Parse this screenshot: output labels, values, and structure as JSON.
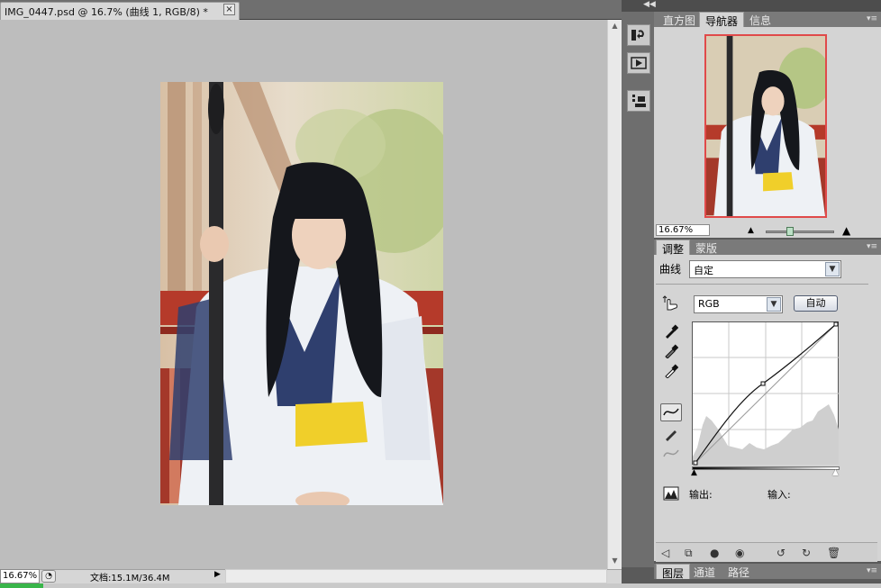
{
  "document": {
    "tab_title": "IMG_0447.psd @ 16.7% (曲线 1, RGB/8) *",
    "close_glyph": "×"
  },
  "status_bar": {
    "zoom": "16.67%",
    "doc_info": "文档:15.1M/36.4M",
    "menu_arrow": "▶"
  },
  "panel_collapse": "◀◀",
  "tool_strip": {
    "icons": [
      "history-brush-icon",
      "play-action-icon",
      "clone-source-icon"
    ]
  },
  "navigator_panel": {
    "tabs": [
      "直方图",
      "导航器",
      "信息"
    ],
    "active_tab": "导航器",
    "zoom": "16.67%",
    "view_box_color": "#e04a4a"
  },
  "adjustments_panel": {
    "tabs": [
      "调整",
      "蒙版"
    ],
    "active_tab": "调整",
    "preset_label": "曲线",
    "preset_value": "自定",
    "channel_value": "RGB",
    "auto_button": "自动",
    "output_label": "输出:",
    "input_label": "输入:"
  },
  "layers_panel": {
    "tabs": [
      "图层",
      "通道",
      "路径"
    ],
    "active_tab": "图层"
  },
  "colors": {
    "canvas_bg": "#bdbdbd",
    "panel_bg": "#d4d4d4",
    "status_green": "#39b54a"
  }
}
